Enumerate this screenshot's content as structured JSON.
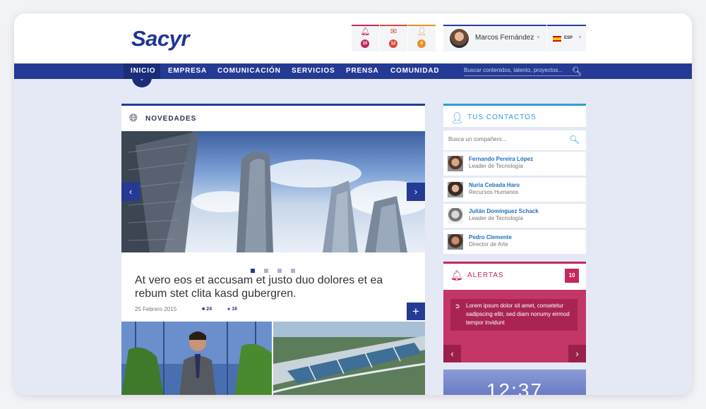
{
  "brand": {
    "logo_text": "Sacyr",
    "primary_color": "#243a94"
  },
  "notifications": [
    {
      "icon": "bell-icon",
      "count": "10",
      "color": "#c4285e"
    },
    {
      "icon": "mail-icon",
      "count": "12",
      "color": "#d94a3a"
    },
    {
      "icon": "user-icon",
      "count": "4",
      "color": "#e8922a"
    }
  ],
  "user": {
    "name": "Marcos Fernández",
    "language": "ESP"
  },
  "nav": {
    "items": [
      "INICIO",
      "EMPRESA",
      "COMUNICACIÓN",
      "SERVICIOS",
      "PRENSA",
      "COMUNIDAD"
    ],
    "active": "INICIO",
    "search_placeholder": "Buscar contenidos, talento, proyectos..."
  },
  "novedades": {
    "title": "NOVEDADES",
    "headline": "At vero eos et accusam et justo duo dolores et ea rebum stet clita kasd gubergren.",
    "date": "25 Febrero 2015",
    "comments": "24",
    "likes": "16",
    "slide_index": 1,
    "slide_count": 4
  },
  "contacts": {
    "title": "TUS CONTACTOS",
    "search_placeholder": "Busca un compañero...",
    "people": [
      {
        "name": "Fernando Pereira López",
        "role": "Leader de Tecnología"
      },
      {
        "name": "Nuria Cebada Haro",
        "role": "Recursos Humanos"
      },
      {
        "name": "Julián Domínguez Schack",
        "role": "Leader de Tecnología"
      },
      {
        "name": "Pedro Clemente",
        "role": "Director de Arte"
      }
    ]
  },
  "alerts": {
    "title": "ALERTAS",
    "count": "10",
    "message": "Lorem ipsum dolor sit amet, consetetur sadipscing elitr, sed diam nonumy eirmod tempor invidunt",
    "color": "#c4285e"
  },
  "clock": {
    "time": "12:37"
  }
}
